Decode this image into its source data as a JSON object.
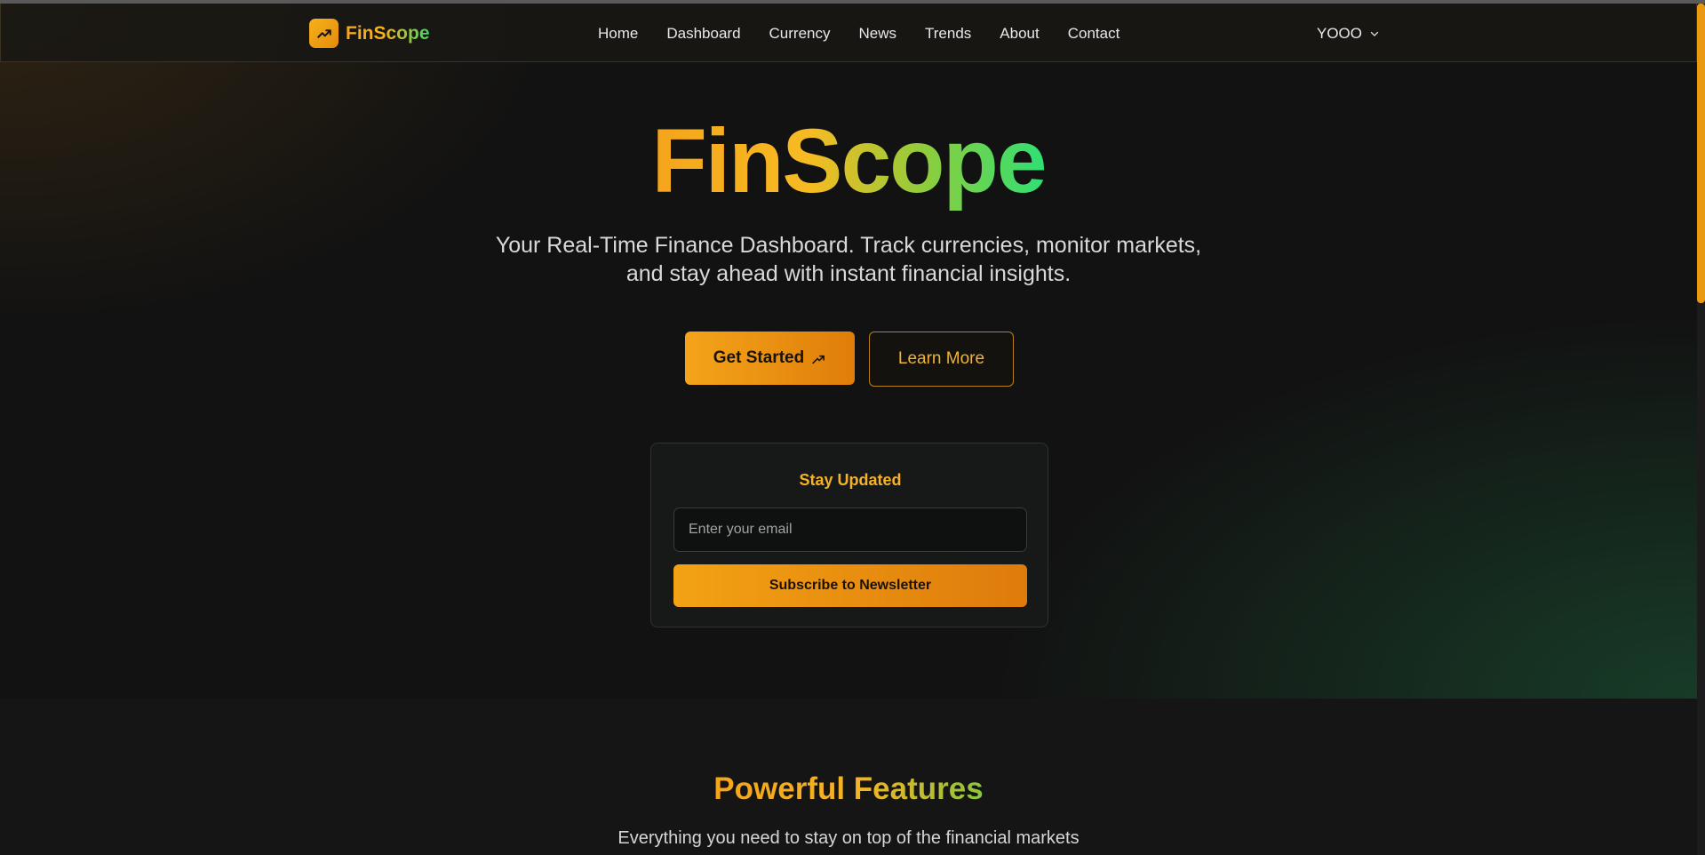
{
  "brand": {
    "name": "FinScope",
    "logo_icon": "trending-up-icon",
    "colors": {
      "accent": "#f5a623",
      "accent_green": "#2fe074",
      "background": "#141414"
    }
  },
  "nav": {
    "links": [
      "Home",
      "Dashboard",
      "Currency",
      "News",
      "Trends",
      "About",
      "Contact"
    ],
    "user": {
      "name": "YOOO",
      "icon": "chevron-down-icon"
    }
  },
  "hero": {
    "title": "FinScope",
    "subtitle": "Your Real-Time Finance Dashboard. Track currencies, monitor markets, and stay ahead with instant financial insights.",
    "primary_button": {
      "label": "Get Started",
      "icon": "trending-arrow-icon"
    },
    "secondary_button": {
      "label": "Learn More"
    }
  },
  "newsletter": {
    "title": "Stay Updated",
    "email_placeholder": "Enter your email",
    "email_value": "",
    "button_label": "Subscribe to Newsletter"
  },
  "features": {
    "title": "Powerful Features",
    "subtitle": "Everything you need to stay on top of the financial markets"
  }
}
